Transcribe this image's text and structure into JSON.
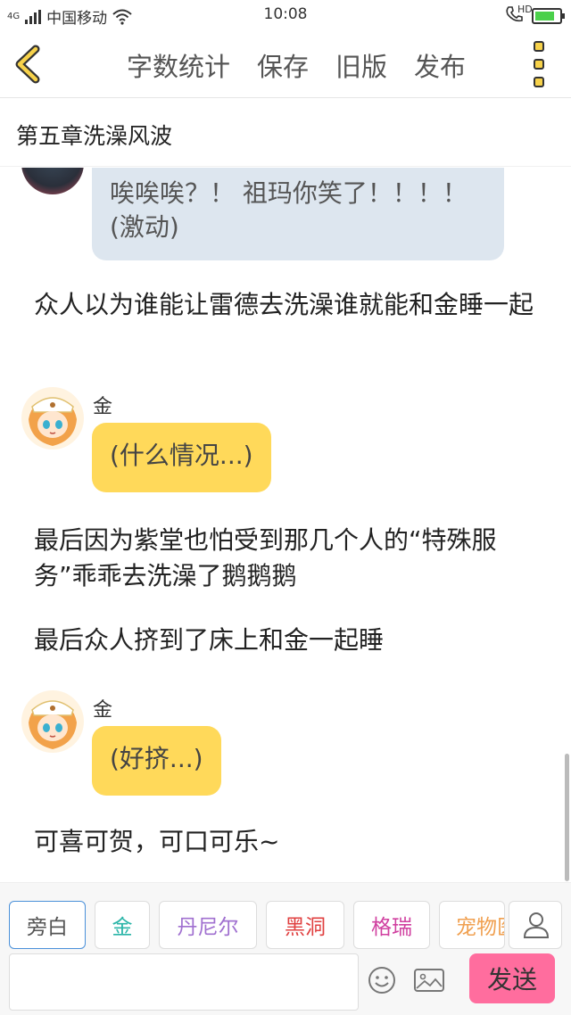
{
  "status_bar": {
    "network": "4G",
    "carrier": "中国移动",
    "time": "10:08",
    "call_badge": "HD",
    "battery_level": 0.8
  },
  "toolbar": {
    "actions": [
      "字数统计",
      "保存",
      "旧版",
      "发布"
    ]
  },
  "chapter": {
    "title": "第五章洗澡风波"
  },
  "content": {
    "bubble_partial": "唉唉唉？！ 祖玛你笑了！！！！(激动)",
    "narration_1": "众人以为谁能让雷德去洗澡谁就能和金睡一起",
    "msg_1": {
      "speaker": "金",
      "text": "(什么情况...)"
    },
    "narration_2": "最后因为紫堂也怕受到那几个人的“特殊服务”乖乖去洗澡了鹅鹅鹅",
    "narration_3": "最后众人挤到了床上和金一起睡",
    "msg_2": {
      "speaker": "金",
      "text": "(好挤...)"
    },
    "narration_4": "可喜可贺，可口可乐~"
  },
  "roles": [
    {
      "label": "旁白",
      "color": "#555555"
    },
    {
      "label": "金",
      "color": "#2bb5a8"
    },
    {
      "label": "丹尼尔",
      "color": "#a070d0"
    },
    {
      "label": "黑洞",
      "color": "#e04040"
    },
    {
      "label": "格瑞",
      "color": "#d040a0"
    },
    {
      "label": "宠物医",
      "color": "#f0a050"
    }
  ],
  "input": {
    "send_label": "发送"
  },
  "colors": {
    "accent_yellow": "#ffd95a",
    "bubble_gray": "#dde6ef",
    "send_pink": "#ff6d9e"
  }
}
